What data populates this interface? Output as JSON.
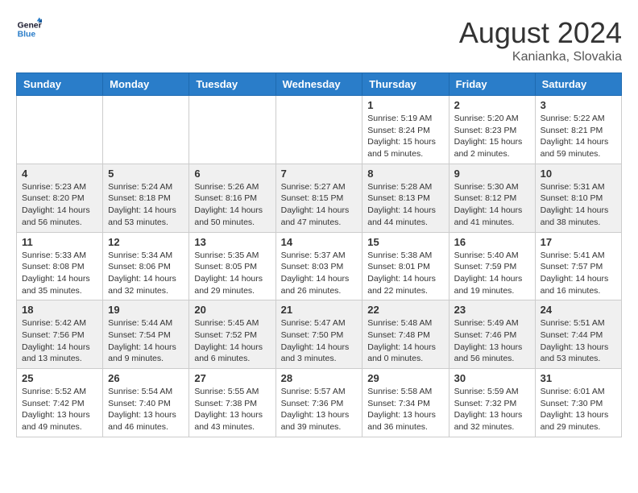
{
  "logo": {
    "line1": "General",
    "line2": "Blue"
  },
  "title": "August 2024",
  "location": "Kanianka, Slovakia",
  "headers": [
    "Sunday",
    "Monday",
    "Tuesday",
    "Wednesday",
    "Thursday",
    "Friday",
    "Saturday"
  ],
  "weeks": [
    [
      {
        "day": "",
        "info": ""
      },
      {
        "day": "",
        "info": ""
      },
      {
        "day": "",
        "info": ""
      },
      {
        "day": "",
        "info": ""
      },
      {
        "day": "1",
        "info": "Sunrise: 5:19 AM\nSunset: 8:24 PM\nDaylight: 15 hours\nand 5 minutes."
      },
      {
        "day": "2",
        "info": "Sunrise: 5:20 AM\nSunset: 8:23 PM\nDaylight: 15 hours\nand 2 minutes."
      },
      {
        "day": "3",
        "info": "Sunrise: 5:22 AM\nSunset: 8:21 PM\nDaylight: 14 hours\nand 59 minutes."
      }
    ],
    [
      {
        "day": "4",
        "info": "Sunrise: 5:23 AM\nSunset: 8:20 PM\nDaylight: 14 hours\nand 56 minutes."
      },
      {
        "day": "5",
        "info": "Sunrise: 5:24 AM\nSunset: 8:18 PM\nDaylight: 14 hours\nand 53 minutes."
      },
      {
        "day": "6",
        "info": "Sunrise: 5:26 AM\nSunset: 8:16 PM\nDaylight: 14 hours\nand 50 minutes."
      },
      {
        "day": "7",
        "info": "Sunrise: 5:27 AM\nSunset: 8:15 PM\nDaylight: 14 hours\nand 47 minutes."
      },
      {
        "day": "8",
        "info": "Sunrise: 5:28 AM\nSunset: 8:13 PM\nDaylight: 14 hours\nand 44 minutes."
      },
      {
        "day": "9",
        "info": "Sunrise: 5:30 AM\nSunset: 8:12 PM\nDaylight: 14 hours\nand 41 minutes."
      },
      {
        "day": "10",
        "info": "Sunrise: 5:31 AM\nSunset: 8:10 PM\nDaylight: 14 hours\nand 38 minutes."
      }
    ],
    [
      {
        "day": "11",
        "info": "Sunrise: 5:33 AM\nSunset: 8:08 PM\nDaylight: 14 hours\nand 35 minutes."
      },
      {
        "day": "12",
        "info": "Sunrise: 5:34 AM\nSunset: 8:06 PM\nDaylight: 14 hours\nand 32 minutes."
      },
      {
        "day": "13",
        "info": "Sunrise: 5:35 AM\nSunset: 8:05 PM\nDaylight: 14 hours\nand 29 minutes."
      },
      {
        "day": "14",
        "info": "Sunrise: 5:37 AM\nSunset: 8:03 PM\nDaylight: 14 hours\nand 26 minutes."
      },
      {
        "day": "15",
        "info": "Sunrise: 5:38 AM\nSunset: 8:01 PM\nDaylight: 14 hours\nand 22 minutes."
      },
      {
        "day": "16",
        "info": "Sunrise: 5:40 AM\nSunset: 7:59 PM\nDaylight: 14 hours\nand 19 minutes."
      },
      {
        "day": "17",
        "info": "Sunrise: 5:41 AM\nSunset: 7:57 PM\nDaylight: 14 hours\nand 16 minutes."
      }
    ],
    [
      {
        "day": "18",
        "info": "Sunrise: 5:42 AM\nSunset: 7:56 PM\nDaylight: 14 hours\nand 13 minutes."
      },
      {
        "day": "19",
        "info": "Sunrise: 5:44 AM\nSunset: 7:54 PM\nDaylight: 14 hours\nand 9 minutes."
      },
      {
        "day": "20",
        "info": "Sunrise: 5:45 AM\nSunset: 7:52 PM\nDaylight: 14 hours\nand 6 minutes."
      },
      {
        "day": "21",
        "info": "Sunrise: 5:47 AM\nSunset: 7:50 PM\nDaylight: 14 hours\nand 3 minutes."
      },
      {
        "day": "22",
        "info": "Sunrise: 5:48 AM\nSunset: 7:48 PM\nDaylight: 14 hours\nand 0 minutes."
      },
      {
        "day": "23",
        "info": "Sunrise: 5:49 AM\nSunset: 7:46 PM\nDaylight: 13 hours\nand 56 minutes."
      },
      {
        "day": "24",
        "info": "Sunrise: 5:51 AM\nSunset: 7:44 PM\nDaylight: 13 hours\nand 53 minutes."
      }
    ],
    [
      {
        "day": "25",
        "info": "Sunrise: 5:52 AM\nSunset: 7:42 PM\nDaylight: 13 hours\nand 49 minutes."
      },
      {
        "day": "26",
        "info": "Sunrise: 5:54 AM\nSunset: 7:40 PM\nDaylight: 13 hours\nand 46 minutes."
      },
      {
        "day": "27",
        "info": "Sunrise: 5:55 AM\nSunset: 7:38 PM\nDaylight: 13 hours\nand 43 minutes."
      },
      {
        "day": "28",
        "info": "Sunrise: 5:57 AM\nSunset: 7:36 PM\nDaylight: 13 hours\nand 39 minutes."
      },
      {
        "day": "29",
        "info": "Sunrise: 5:58 AM\nSunset: 7:34 PM\nDaylight: 13 hours\nand 36 minutes."
      },
      {
        "day": "30",
        "info": "Sunrise: 5:59 AM\nSunset: 7:32 PM\nDaylight: 13 hours\nand 32 minutes."
      },
      {
        "day": "31",
        "info": "Sunrise: 6:01 AM\nSunset: 7:30 PM\nDaylight: 13 hours\nand 29 minutes."
      }
    ]
  ]
}
